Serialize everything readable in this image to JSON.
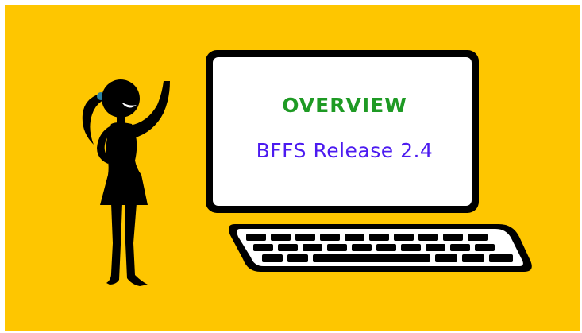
{
  "slide": {
    "background_color": "#fec600",
    "title": "OVERVIEW",
    "subtitle": "BFFS Release 2.4",
    "title_color": "#1e9a24",
    "subtitle_color": "#4c1bf0"
  },
  "illustration": {
    "figure": "woman-waving-icon",
    "device": "computer-monitor-icon",
    "keyboard": "keyboard-icon"
  }
}
